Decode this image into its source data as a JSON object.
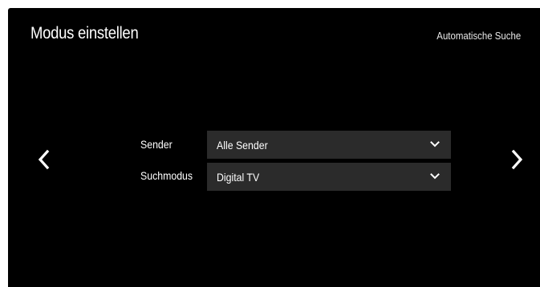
{
  "header": {
    "title": "Modus einstellen",
    "subtitle": "Automatische Suche"
  },
  "navigation": {
    "previous_icon": "chevron-left-icon",
    "next_icon": "chevron-right-icon"
  },
  "settings": {
    "sender": {
      "label": "Sender",
      "value": "Alle Sender",
      "icon": "chevron-down-icon"
    },
    "suchmodus": {
      "label": "Suchmodus",
      "value": "Digital TV",
      "icon": "chevron-down-icon"
    }
  },
  "colors": {
    "background": "#000000",
    "dropdown_background": "#2b2b2b",
    "text": "#ffffff"
  }
}
